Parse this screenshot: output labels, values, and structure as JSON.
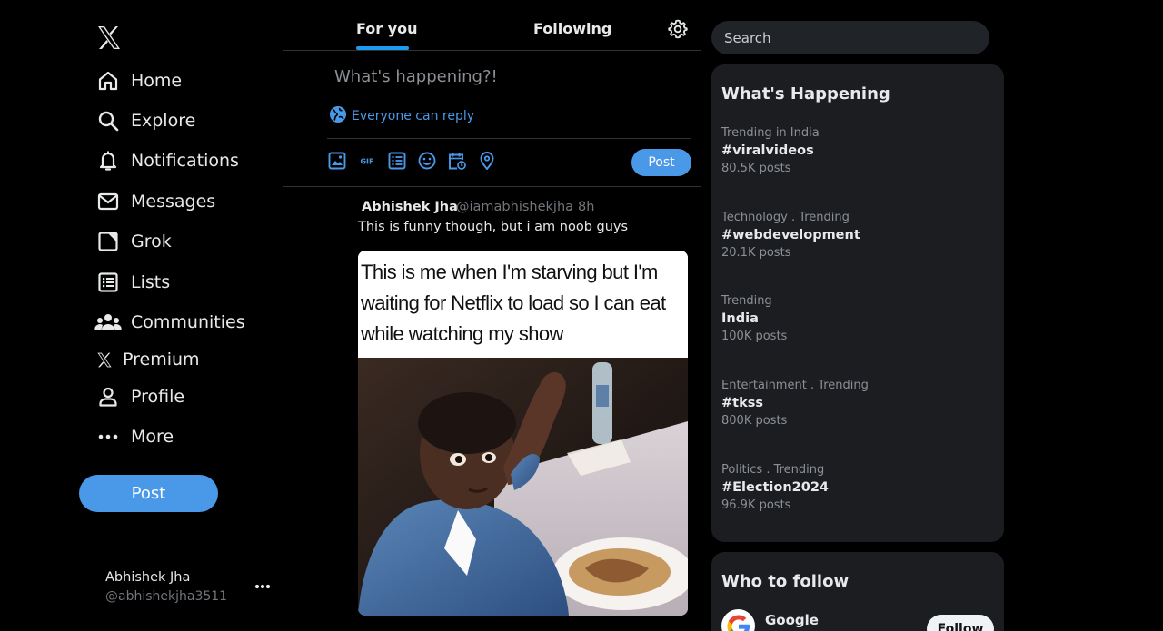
{
  "sidebar": {
    "logo_icon": "x-logo-icon",
    "items": [
      {
        "label": "Home",
        "icon": "home-icon"
      },
      {
        "label": "Explore",
        "icon": "search-icon"
      },
      {
        "label": "Notifications",
        "icon": "bell-icon"
      },
      {
        "label": "Messages",
        "icon": "envelope-icon"
      },
      {
        "label": "Grok",
        "icon": "grok-icon"
      },
      {
        "label": "Lists",
        "icon": "list-icon"
      },
      {
        "label": "Communities",
        "icon": "people-icon"
      },
      {
        "label": "Premium",
        "icon": "x-logo-icon"
      },
      {
        "label": "Profile",
        "icon": "person-icon"
      },
      {
        "label": "More",
        "icon": "more-dots-icon"
      }
    ],
    "post_label": "Post",
    "account": {
      "name": "Abhishek Jha",
      "handle": "@abhishekjha3511"
    }
  },
  "main": {
    "tabs": [
      {
        "label": "For you",
        "active": true
      },
      {
        "label": "Following",
        "active": false
      }
    ],
    "composer": {
      "placeholder": "What's happening?!",
      "reply_setting": "Everyone can reply",
      "post_label": "Post",
      "tool_icons": [
        "image-icon",
        "gif-icon",
        "poll-icon",
        "emoji-icon",
        "schedule-icon",
        "location-icon"
      ]
    },
    "tweet": {
      "author": "Abhishek Jha",
      "handle": "@iamabhishekjha",
      "separator": ".",
      "time": "8h",
      "text": "This is funny though, but i am noob guys",
      "media_caption": [
        "This is me when I'm starving but I'm",
        "waiting for Netflix to load so I can eat",
        "while watching my show"
      ]
    }
  },
  "right": {
    "search_placeholder": "Search",
    "whats_happening": {
      "title": "What's Happening",
      "trends": [
        {
          "context": "Trending in India",
          "topic": "#viralvideos",
          "posts": "80.5K posts"
        },
        {
          "context": "Technology . Trending",
          "topic": "#webdevelopment",
          "posts": "20.1K posts"
        },
        {
          "context": "Trending",
          "topic": "India",
          "posts": "100K posts"
        },
        {
          "context": "Entertainment . Trending",
          "topic": "#tkss",
          "posts": "800K posts"
        },
        {
          "context": "Politics . Trending",
          "topic": "#Election2024",
          "posts": "96.9K posts"
        }
      ]
    },
    "who_to_follow": {
      "title": "Who to follow",
      "accounts": [
        {
          "name": "Google",
          "button": "Follow",
          "icon": "google-logo-icon"
        }
      ]
    }
  },
  "colors": {
    "accent": "#4a99e9",
    "background": "#000000",
    "panel": "#1b1d21",
    "muted_text": "#71767b"
  }
}
